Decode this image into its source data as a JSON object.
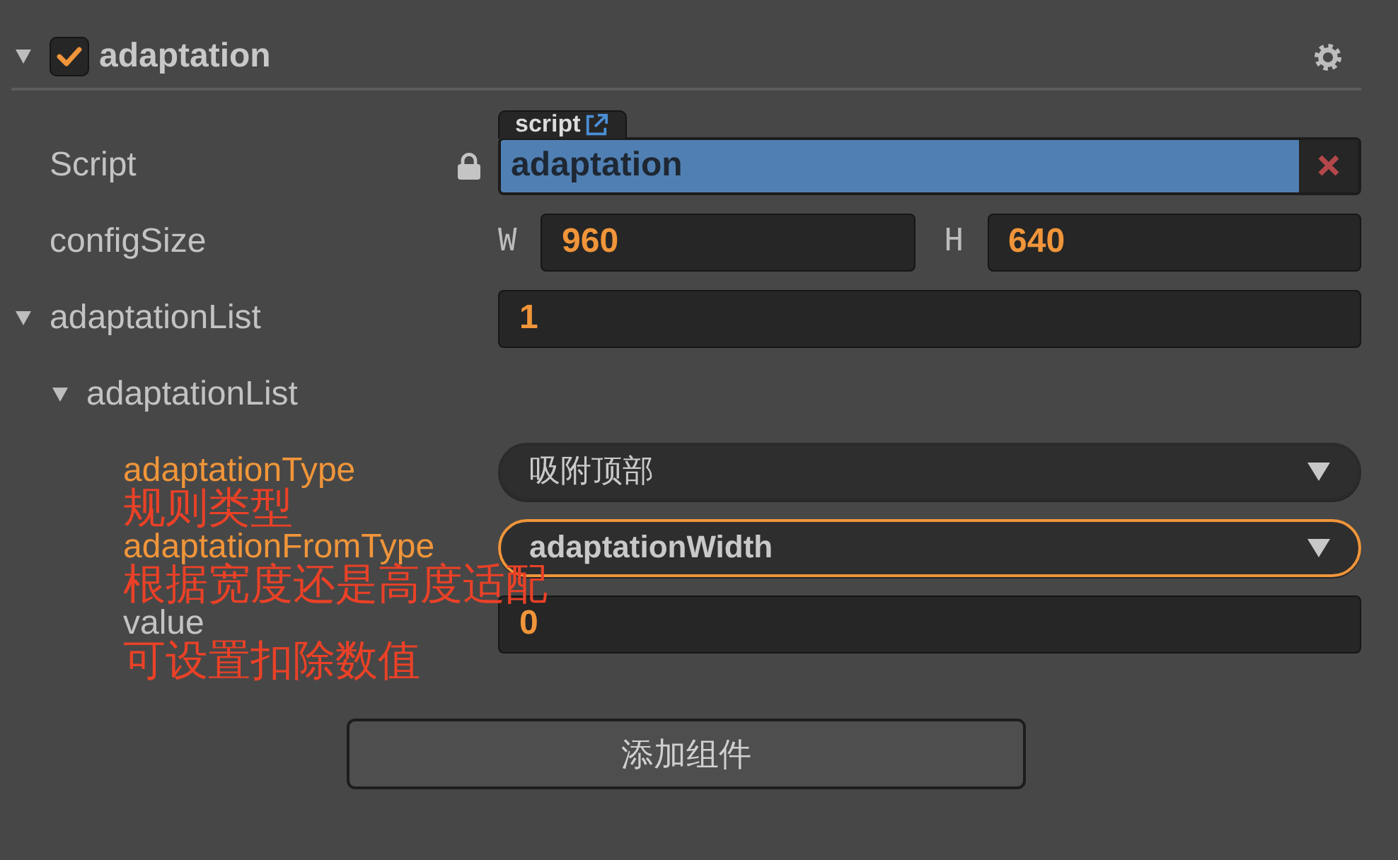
{
  "component": {
    "title": "adaptation",
    "expanded": true,
    "enabled": true
  },
  "properties": [
    {
      "kind": "script",
      "label": "Script",
      "locked": true,
      "tab": "script",
      "value": "adaptation"
    },
    {
      "kind": "size",
      "label": "configSize",
      "fields": [
        {
          "axis": "W",
          "value": "960"
        },
        {
          "axis": "H",
          "value": "640"
        }
      ]
    },
    {
      "kind": "number",
      "label": "adaptationList",
      "expanded": true,
      "value": "1",
      "children": [
        {
          "label": "adaptationList",
          "expanded": true,
          "children": [
            {
              "kind": "select",
              "label": "adaptationType",
              "modified": true,
              "value": "吸附顶部",
              "focused": false,
              "note": "规则类型"
            },
            {
              "kind": "select",
              "label": "adaptationFromType",
              "modified": true,
              "value": "adaptationWidth",
              "focused": true,
              "note": "根据宽度还是高度适配"
            },
            {
              "kind": "number",
              "label": "value",
              "modified": false,
              "value": "0",
              "note": "可设置扣除数值"
            }
          ]
        }
      ]
    }
  ],
  "add_button": "添加组件"
}
